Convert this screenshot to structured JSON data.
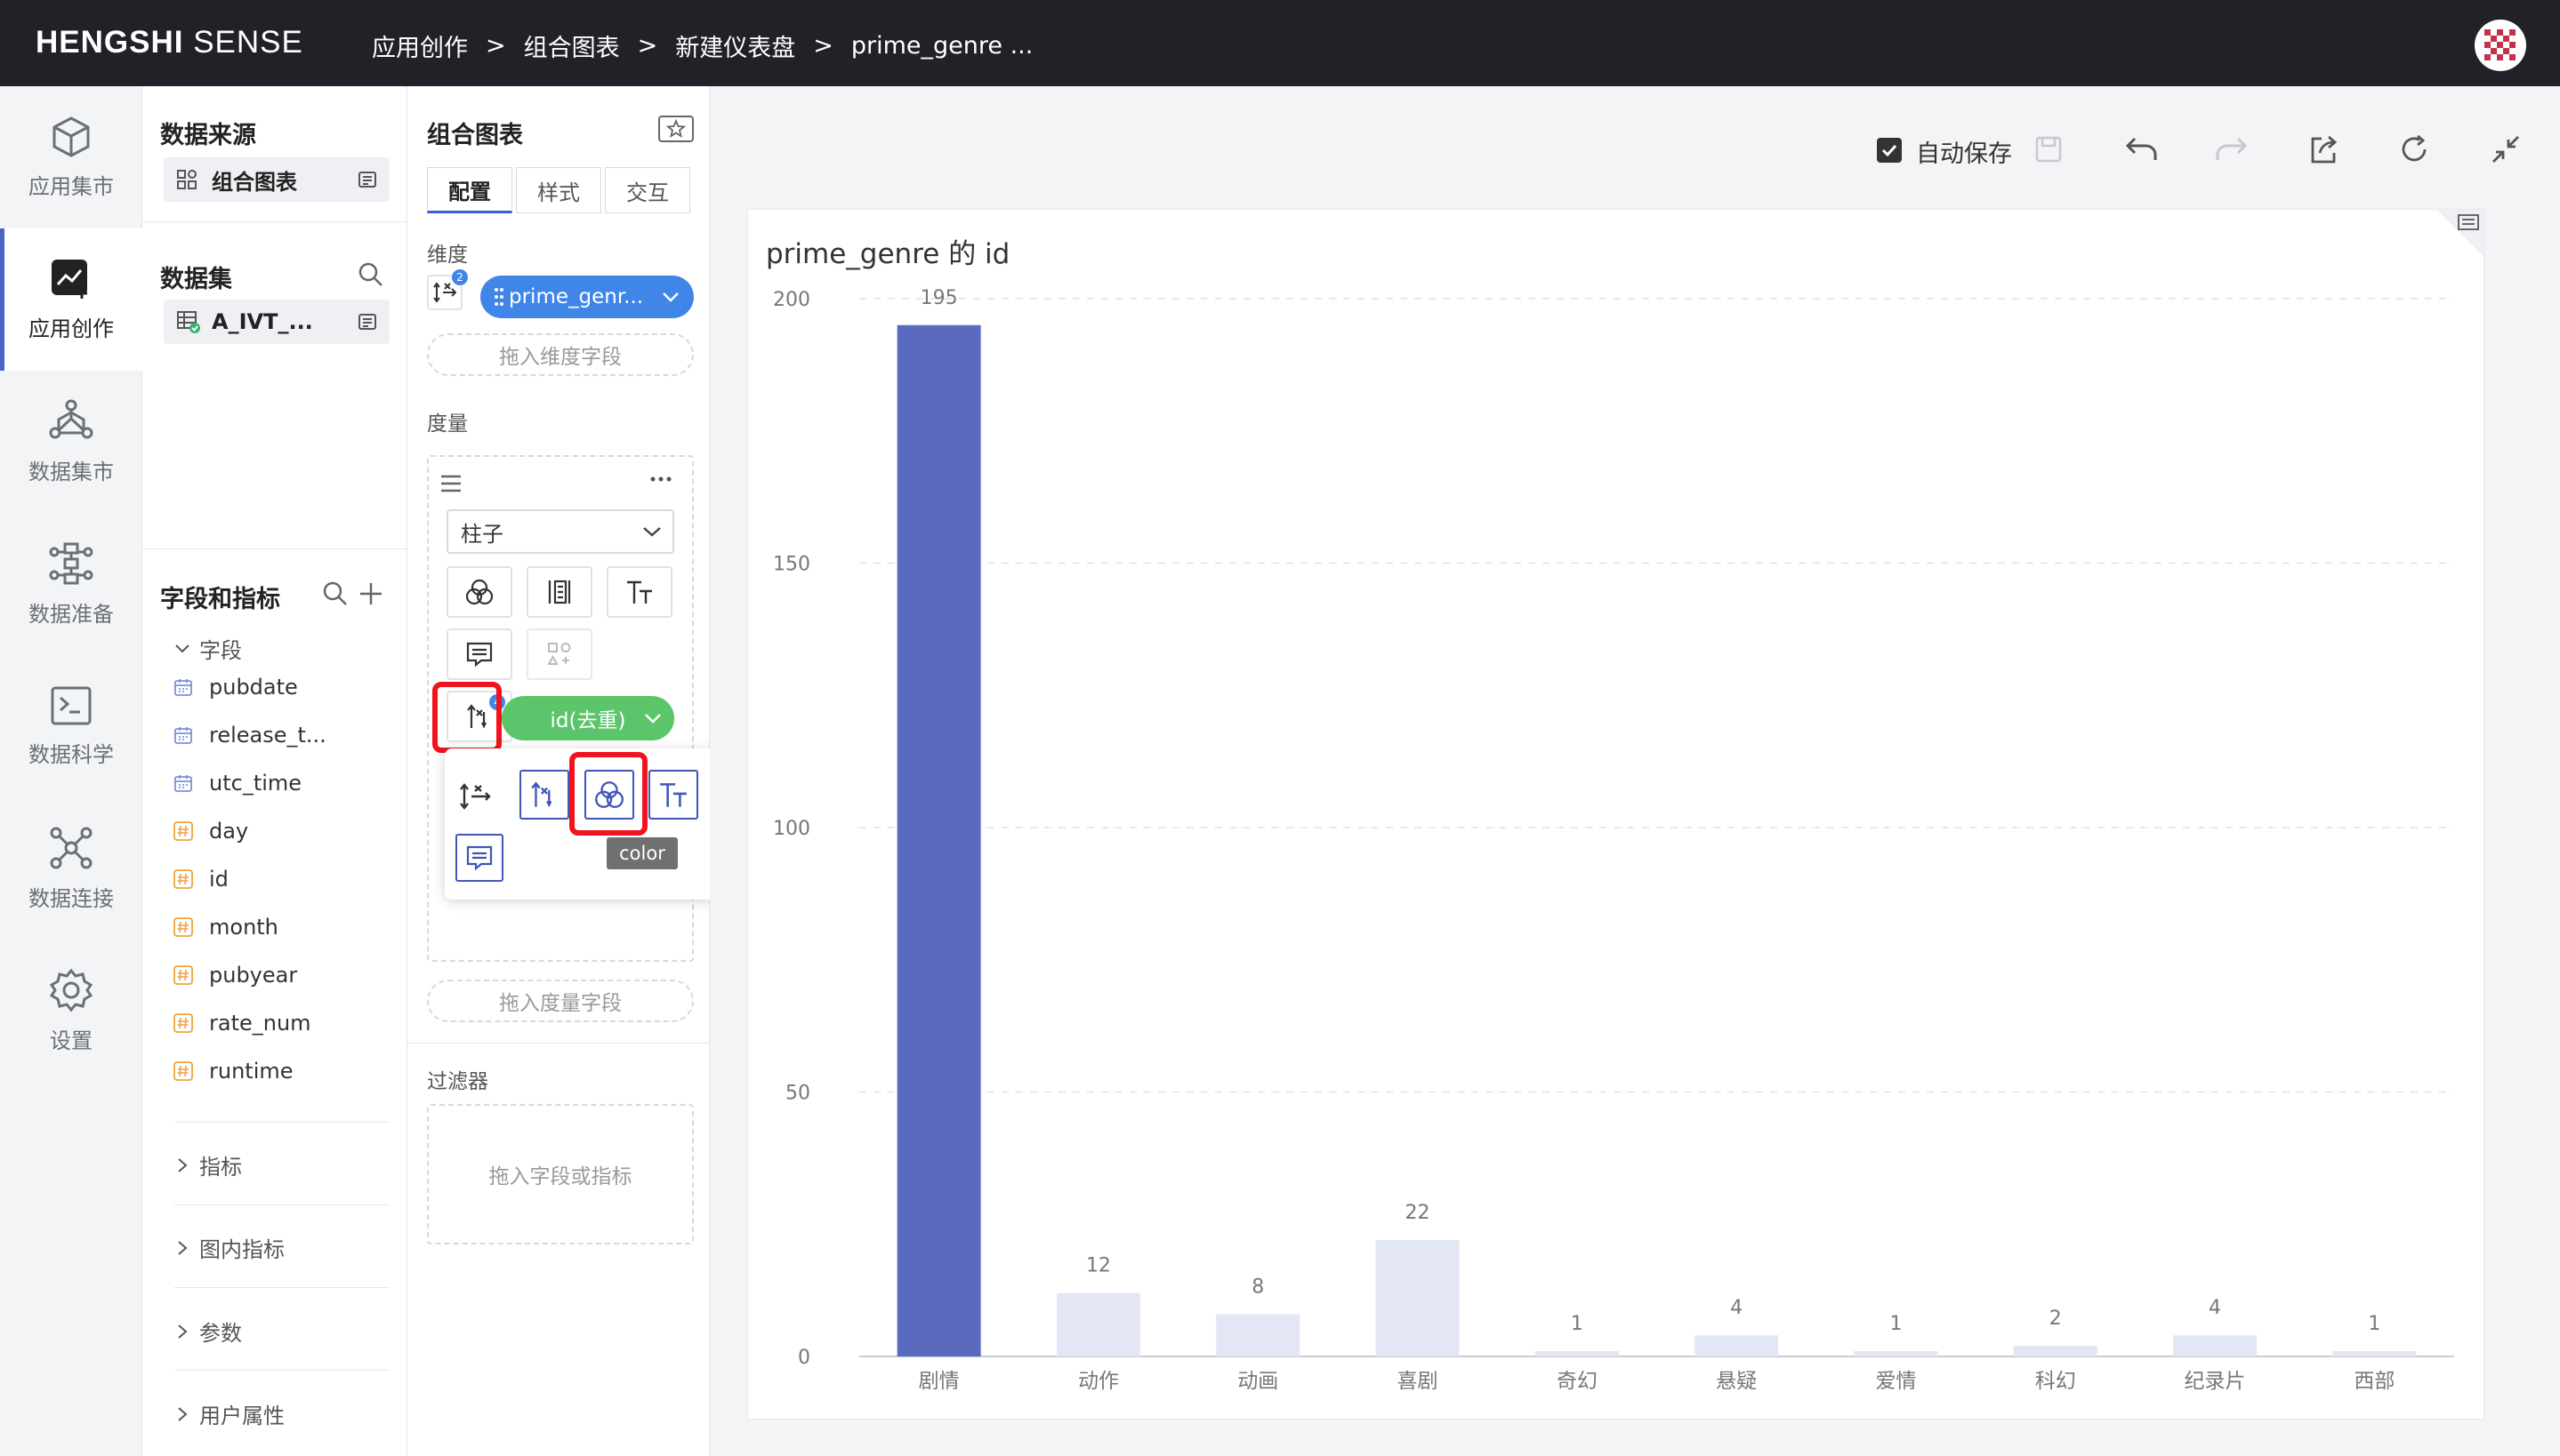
{
  "app": {
    "brand_bold": "HENGSHI",
    "brand_light": " SENSE"
  },
  "breadcrumb": [
    "应用创作",
    "组合图表",
    "新建仪表盘",
    "prime_genre ..."
  ],
  "breadcrumb_sep": ">",
  "nav": [
    {
      "label": "应用集市",
      "icon": "cube-icon"
    },
    {
      "label": "应用创作",
      "icon": "chart-edit-icon",
      "active": true
    },
    {
      "label": "数据集市",
      "icon": "network-icon"
    },
    {
      "label": "数据准备",
      "icon": "flow-icon"
    },
    {
      "label": "数据科学",
      "icon": "terminal-icon"
    },
    {
      "label": "数据连接",
      "icon": "connection-icon"
    },
    {
      "label": "设置",
      "icon": "gear-icon"
    }
  ],
  "panel1": {
    "source_title": "数据来源",
    "source_item": "组合图表",
    "dataset_title": "数据集",
    "dataset_item": "A_IVT_...",
    "fields_title": "字段和指标",
    "fields_group": "字段",
    "fields": [
      {
        "name": "pubdate",
        "type": "date"
      },
      {
        "name": "release_t...",
        "type": "date"
      },
      {
        "name": "utc_time",
        "type": "date"
      },
      {
        "name": "day",
        "type": "number"
      },
      {
        "name": "id",
        "type": "number"
      },
      {
        "name": "month",
        "type": "number"
      },
      {
        "name": "pubyear",
        "type": "number"
      },
      {
        "name": "rate_num",
        "type": "number"
      },
      {
        "name": "runtime",
        "type": "number"
      }
    ],
    "groups": [
      "指标",
      "图内指标",
      "参数",
      "用户属性"
    ]
  },
  "panel2": {
    "title": "组合图表",
    "tabs": [
      "配置",
      "样式",
      "交互"
    ],
    "dimension_label": "维度",
    "dimension_badge": "2",
    "dimension_pill": "prime_genr...",
    "dimension_drop": "拖入维度字段",
    "measure_label": "度量",
    "chart_type": "柱子",
    "measure_badge": "4",
    "measure_pill": "id(去重)",
    "measure_drop": "拖入度量字段",
    "tooltip": "color",
    "filter_label": "过滤器",
    "filter_drop": "拖入字段或指标"
  },
  "toolbar": {
    "autosave_label": "自动保存",
    "autosave_checked": true
  },
  "colors": {
    "bar_main": "#5a6abf",
    "bar_light": "#e3e6f5",
    "pill_blue": "#3f86e8",
    "pill_green": "#5cc56b",
    "highlight": "#f0141e"
  },
  "chart_data": {
    "type": "bar",
    "title": "prime_genre 的 id",
    "categories": [
      "剧情",
      "动作",
      "动画",
      "喜剧",
      "奇幻",
      "悬疑",
      "爱情",
      "科幻",
      "纪录片",
      "西部"
    ],
    "values": [
      195,
      12,
      8,
      22,
      1,
      4,
      1,
      2,
      4,
      1
    ],
    "highlighted": "剧情",
    "yticks": [
      0,
      50,
      100,
      150,
      200
    ],
    "ylim": [
      0,
      200
    ],
    "grid": true
  }
}
